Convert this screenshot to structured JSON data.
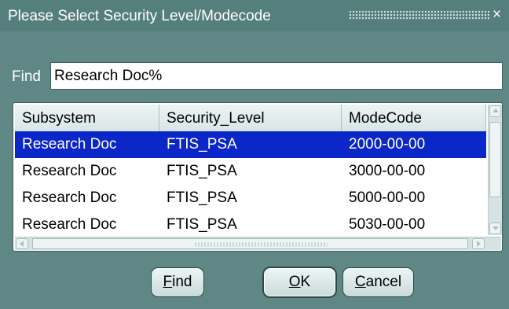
{
  "window": {
    "title": "Please Select Security Level/Modecode",
    "close_glyph": "×"
  },
  "find": {
    "label": "Find",
    "value": "Research Doc%"
  },
  "table": {
    "columns": [
      "Subsystem",
      "Security_Level",
      "ModeCode"
    ],
    "rows": [
      {
        "subsystem": "Research Doc",
        "security_level": "FTIS_PSA",
        "modecode": "2000-00-00",
        "selected": true
      },
      {
        "subsystem": "Research Doc",
        "security_level": "FTIS_PSA",
        "modecode": "3000-00-00",
        "selected": false
      },
      {
        "subsystem": "Research Doc",
        "security_level": "FTIS_PSA",
        "modecode": "5000-00-00",
        "selected": false
      },
      {
        "subsystem": "Research Doc",
        "security_level": "FTIS_PSA",
        "modecode": "5030-00-00",
        "selected": false
      }
    ]
  },
  "buttons": {
    "find": {
      "mnemonic": "F",
      "rest": "ind"
    },
    "ok": {
      "mnemonic": "O",
      "rest": "K"
    },
    "cancel": {
      "mnemonic": "C",
      "rest": "ancel"
    }
  },
  "colors": {
    "dialog_background": "#5f8786",
    "selection": "#0b27c8",
    "title_text": "#ffffff"
  },
  "icons": {
    "close": "close-icon",
    "scroll_up": "arrow-up-icon",
    "scroll_down": "arrow-down-icon",
    "scroll_left": "arrow-left-icon",
    "scroll_right": "arrow-right-icon"
  }
}
